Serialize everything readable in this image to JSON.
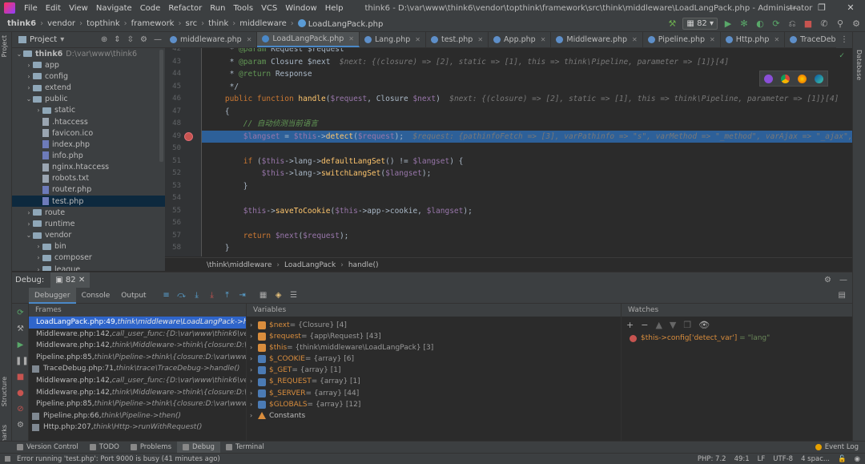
{
  "menu": {
    "items": [
      "File",
      "Edit",
      "View",
      "Navigate",
      "Code",
      "Refactor",
      "Run",
      "Tools",
      "VCS",
      "Window",
      "Help"
    ],
    "title": "think6 - D:\\var\\www\\think6\\vendor\\topthink\\framework\\src\\think\\middleware\\LoadLangPack.php - Administrator"
  },
  "breadcrumbs": [
    "think6",
    "vendor",
    "topthink",
    "framework",
    "src",
    "think",
    "middleware",
    "LoadLangPack.php"
  ],
  "run_config": "82",
  "project": {
    "title": "Project",
    "tree": [
      {
        "label": "think6",
        "extra": "D:\\var\\www\\think6",
        "level": 0,
        "type": "folder",
        "open": true
      },
      {
        "label": "app",
        "level": 1,
        "type": "folder"
      },
      {
        "label": "config",
        "level": 1,
        "type": "folder"
      },
      {
        "label": "extend",
        "level": 1,
        "type": "folder"
      },
      {
        "label": "public",
        "level": 1,
        "type": "folder",
        "open": true
      },
      {
        "label": "static",
        "level": 2,
        "type": "folder"
      },
      {
        "label": ".htaccess",
        "level": 2,
        "type": "file"
      },
      {
        "label": "favicon.ico",
        "level": 2,
        "type": "file"
      },
      {
        "label": "index.php",
        "level": 2,
        "type": "php"
      },
      {
        "label": "info.php",
        "level": 2,
        "type": "php"
      },
      {
        "label": "nginx.htaccess",
        "level": 2,
        "type": "file"
      },
      {
        "label": "robots.txt",
        "level": 2,
        "type": "file"
      },
      {
        "label": "router.php",
        "level": 2,
        "type": "php"
      },
      {
        "label": "test.php",
        "level": 2,
        "type": "php",
        "selected": true
      },
      {
        "label": "route",
        "level": 1,
        "type": "folder"
      },
      {
        "label": "runtime",
        "level": 1,
        "type": "folder"
      },
      {
        "label": "vendor",
        "level": 1,
        "type": "folder",
        "open": true
      },
      {
        "label": "bin",
        "level": 2,
        "type": "folder"
      },
      {
        "label": "composer",
        "level": 2,
        "type": "folder"
      },
      {
        "label": "league",
        "level": 2,
        "type": "folder"
      }
    ]
  },
  "tabs": [
    {
      "label": "middleware.php"
    },
    {
      "label": "LoadLangPack.php",
      "active": true
    },
    {
      "label": "Lang.php"
    },
    {
      "label": "test.php"
    },
    {
      "label": "App.php"
    },
    {
      "label": "Middleware.php"
    },
    {
      "label": "Pipeline.php"
    },
    {
      "label": "Http.php"
    },
    {
      "label": "TraceDebug.php"
    },
    {
      "label": "In"
    }
  ],
  "editor": {
    "lines": [
      {
        "n": "42",
        "html": "     * <span class=\"dc\">@param</span> Request $request"
      },
      {
        "n": "43",
        "html": "     * <span class=\"dc\">@param</span> Closure $next  <span class=\"ghost\">$next: {(closure) => [2], static => [1], this => think\\Pipeline, parameter => [1]}[4]</span>"
      },
      {
        "n": "44",
        "html": "     * <span class=\"dc\">@return</span> Response"
      },
      {
        "n": "45",
        "html": "     */"
      },
      {
        "n": "46",
        "html": "    <span class=\"kw\">public function</span> <span class=\"fn\">handle</span>(<span class=\"var\">$request</span>, Closure <span class=\"var\">$next</span>)  <span class=\"ghost\">$next: {(closure) => [2], static => [1], this => think\\Pipeline, parameter => [1]}[4]   $r</span>"
      },
      {
        "n": "47",
        "html": "    {"
      },
      {
        "n": "48",
        "html": "        <span class=\"cm\">// 自动侦测当前语言</span>"
      },
      {
        "n": "49",
        "html": "        <span class=\"var\">$langset</span> = <span class=\"var\">$this</span>-><span class=\"fn\">detect</span>(<span class=\"var\">$request</span>);  <span class=\"ghost\">$request: {pathinfoFetch => [3], varPathinfo => \"s\", varMethod => \"_method\", varAjax => \"_ajax\",</span>",
        "hl": true,
        "bp": true
      },
      {
        "n": "50",
        "html": ""
      },
      {
        "n": "51",
        "html": "        <span class=\"kw\">if</span> (<span class=\"var\">$this</span>->lang-><span class=\"fn\">defaultLangSet</span>() != <span class=\"var\">$langset</span>) {"
      },
      {
        "n": "52",
        "html": "            <span class=\"var\">$this</span>->lang-><span class=\"fn\">switchLangSet</span>(<span class=\"var\">$langset</span>);"
      },
      {
        "n": "53",
        "html": "        }"
      },
      {
        "n": "54",
        "html": ""
      },
      {
        "n": "55",
        "html": "        <span class=\"var\">$this</span>-><span class=\"fn\">saveToCookie</span>(<span class=\"var\">$this</span>->app->cookie, <span class=\"var\">$langset</span>);"
      },
      {
        "n": "56",
        "html": ""
      },
      {
        "n": "57",
        "html": "        <span class=\"kw\">return</span> <span class=\"var\">$next</span>(<span class=\"var\">$request</span>);"
      },
      {
        "n": "58",
        "html": "    }"
      }
    ],
    "breadcrumb": [
      "\\think\\middleware",
      "LoadLangPack",
      "handle()"
    ]
  },
  "debug": {
    "label": "Debug:",
    "tab": "82",
    "subtabs": [
      "Debugger",
      "Console",
      "Output"
    ],
    "frames_title": "Frames",
    "variables_title": "Variables",
    "watches_title": "Watches",
    "frames": [
      {
        "file": "LoadLangPack.php:49,",
        "ctx": "think\\middleware\\LoadLangPack->han",
        "sel": true
      },
      {
        "file": "Middleware.php:142,",
        "ctx": "call_user_func:{D:\\var\\www\\think6\\vendo"
      },
      {
        "file": "Middleware.php:142,",
        "ctx": "think\\Middleware->think\\{closure:D:\\var\\ww"
      },
      {
        "file": "Pipeline.php:85,",
        "ctx": "think\\Pipeline->think\\{closure:D:\\var\\www\\th"
      },
      {
        "file": "TraceDebug.php:71,",
        "ctx": "think\\trace\\TraceDebug->handle()"
      },
      {
        "file": "Middleware.php:142,",
        "ctx": "call_user_func:{D:\\var\\www\\think6\\vendo"
      },
      {
        "file": "Middleware.php:142,",
        "ctx": "think\\Middleware->think\\{closure:D:\\var\\ww"
      },
      {
        "file": "Pipeline.php:85,",
        "ctx": "think\\Pipeline->think\\{closure:D:\\var\\www\\th"
      },
      {
        "file": "Pipeline.php:66,",
        "ctx": "think\\Pipeline->then()"
      },
      {
        "file": "Http.php:207,",
        "ctx": "think\\Http->runWithRequest()"
      }
    ],
    "variables": [
      {
        "name": "$next",
        "val": "= {Closure} [4]",
        "kind": "obj"
      },
      {
        "name": "$request",
        "val": "= {app\\Request} [43]",
        "kind": "obj"
      },
      {
        "name": "$this",
        "val": "= {think\\middleware\\LoadLangPack} [3]",
        "kind": "obj"
      },
      {
        "name": "$_COOKIE",
        "val": "= {array} [6]",
        "kind": "arr"
      },
      {
        "name": "$_GET",
        "val": "= {array} [1]",
        "kind": "arr"
      },
      {
        "name": "$_REQUEST",
        "val": "= {array} [1]",
        "kind": "arr"
      },
      {
        "name": "$_SERVER",
        "val": "= {array} [44]",
        "kind": "arr"
      },
      {
        "name": "$GLOBALS",
        "val": "= {array} [12]",
        "kind": "arr"
      },
      {
        "name": "Constants",
        "val": "",
        "kind": "const"
      }
    ],
    "watch": {
      "key": "$this->config['detect_var']",
      "val": "= \"lang\""
    }
  },
  "bottom_tabs": [
    "Version Control",
    "TODO",
    "Problems",
    "Debug",
    "Terminal"
  ],
  "event_log": "Event Log",
  "status": {
    "message": "Error running 'test.php': Port 9000 is busy (41 minutes ago)",
    "php": "PHP: 7.2",
    "pos": "49:1",
    "eol": "LF",
    "enc": "UTF-8",
    "indent": "4 spac..."
  },
  "side_labels": {
    "project": "Project",
    "structure": "Structure",
    "bookmarks": "Bookmarks",
    "database": "Database"
  }
}
